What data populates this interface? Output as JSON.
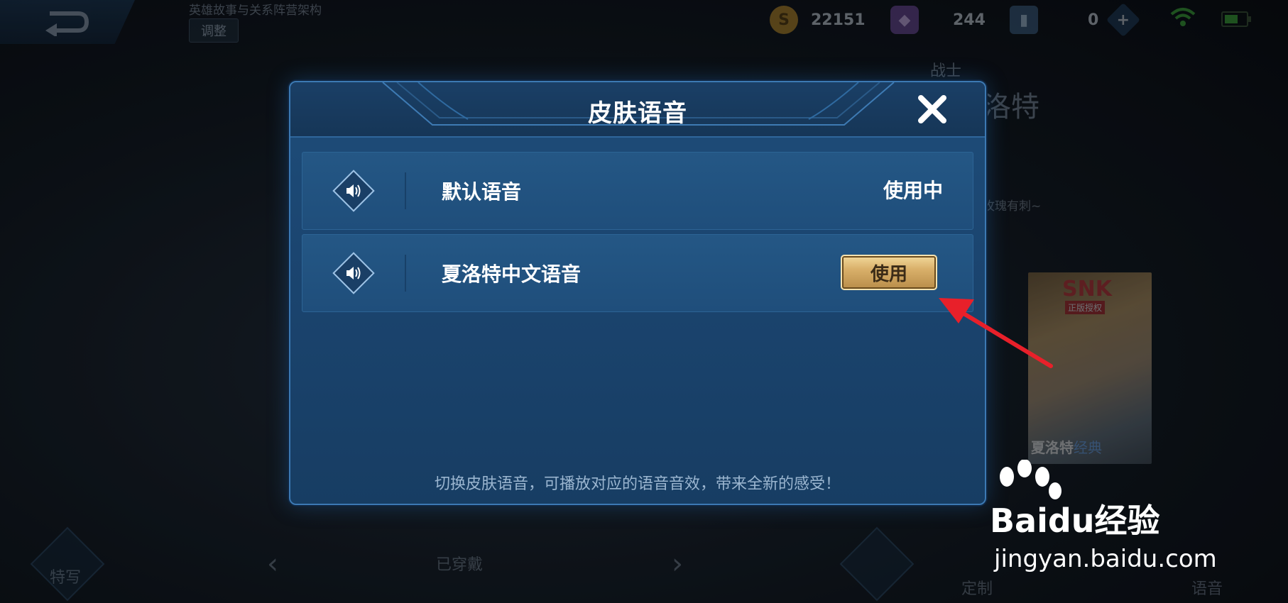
{
  "background": {
    "top_subtitle": "英雄故事与关系阵营架构",
    "adjust_label": "调整",
    "currencies": [
      {
        "icon": "gold-coin-icon",
        "value": "22151"
      },
      {
        "icon": "gem-icon",
        "value": "244"
      },
      {
        "icon": "card-icon",
        "value": "0"
      }
    ],
    "hero_class": "战士",
    "hero_name": "洛特",
    "hero_hint": "玫瑰有刺~",
    "skin_card": {
      "brand": "SNK",
      "brand_sub": "正版授权",
      "name_prefix": "夏洛特",
      "name_suffix": "经典"
    },
    "bottom": {
      "feature_label": "特写",
      "equipped_label": "已穿戴",
      "customize_label": "定制",
      "voice_label": "语音"
    }
  },
  "modal": {
    "title": "皮肤语音",
    "voices": [
      {
        "name": "默认语音",
        "status": "使用中"
      },
      {
        "name": "夏洛特中文语音",
        "action": "使用"
      }
    ],
    "footer": "切换皮肤语音，可播放对应的语音音效，带来全新的感受！"
  },
  "watermark": {
    "brand": "Baidu经验",
    "url": "jingyan.baidu.com"
  },
  "colors": {
    "modal_bg": "#1b4570",
    "row_bg": "#245785",
    "use_button": "#d9b06a",
    "arrow": "#e8202a"
  }
}
